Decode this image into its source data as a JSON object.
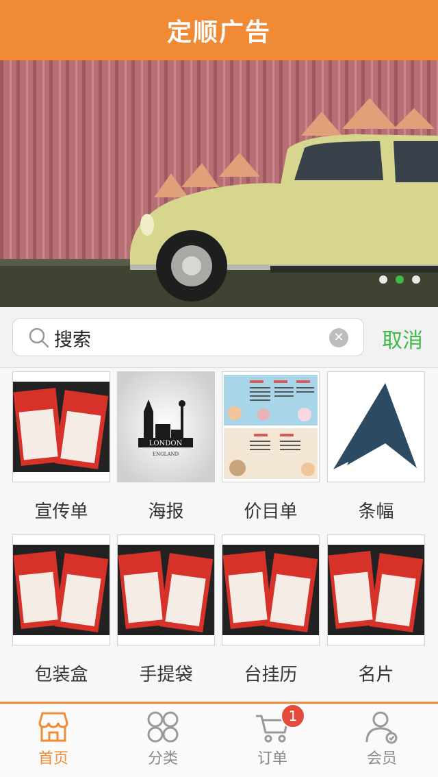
{
  "header": {
    "title": "定顺广告"
  },
  "banner": {
    "slides": 3,
    "active_slide": 2
  },
  "search": {
    "value": "搜索",
    "cancel_label": "取消"
  },
  "categories": [
    {
      "label": "宣传单",
      "icon": "flyer-thumbnail"
    },
    {
      "label": "海报",
      "icon": "poster-thumbnail"
    },
    {
      "label": "价目单",
      "icon": "price-list-thumbnail"
    },
    {
      "label": "条幅",
      "icon": "banner-arrow-thumbnail"
    },
    {
      "label": "包装盒",
      "icon": "flyer-thumbnail"
    },
    {
      "label": "手提袋",
      "icon": "flyer-thumbnail"
    },
    {
      "label": "台挂历",
      "icon": "flyer-thumbnail"
    },
    {
      "label": "名片",
      "icon": "flyer-thumbnail"
    }
  ],
  "poster_text": {
    "line1": "LONDON",
    "line2": "ENGLAND"
  },
  "tabbar": {
    "tabs": [
      {
        "label": "首页",
        "icon": "store-icon"
      },
      {
        "label": "分类",
        "icon": "category-icon"
      },
      {
        "label": "订单",
        "icon": "cart-icon",
        "badge": "1"
      },
      {
        "label": "会员",
        "icon": "user-icon"
      }
    ],
    "active_tab": 0
  },
  "colors": {
    "accent": "#f08a35",
    "green": "#3dbb45",
    "badge": "#e54b3c"
  }
}
